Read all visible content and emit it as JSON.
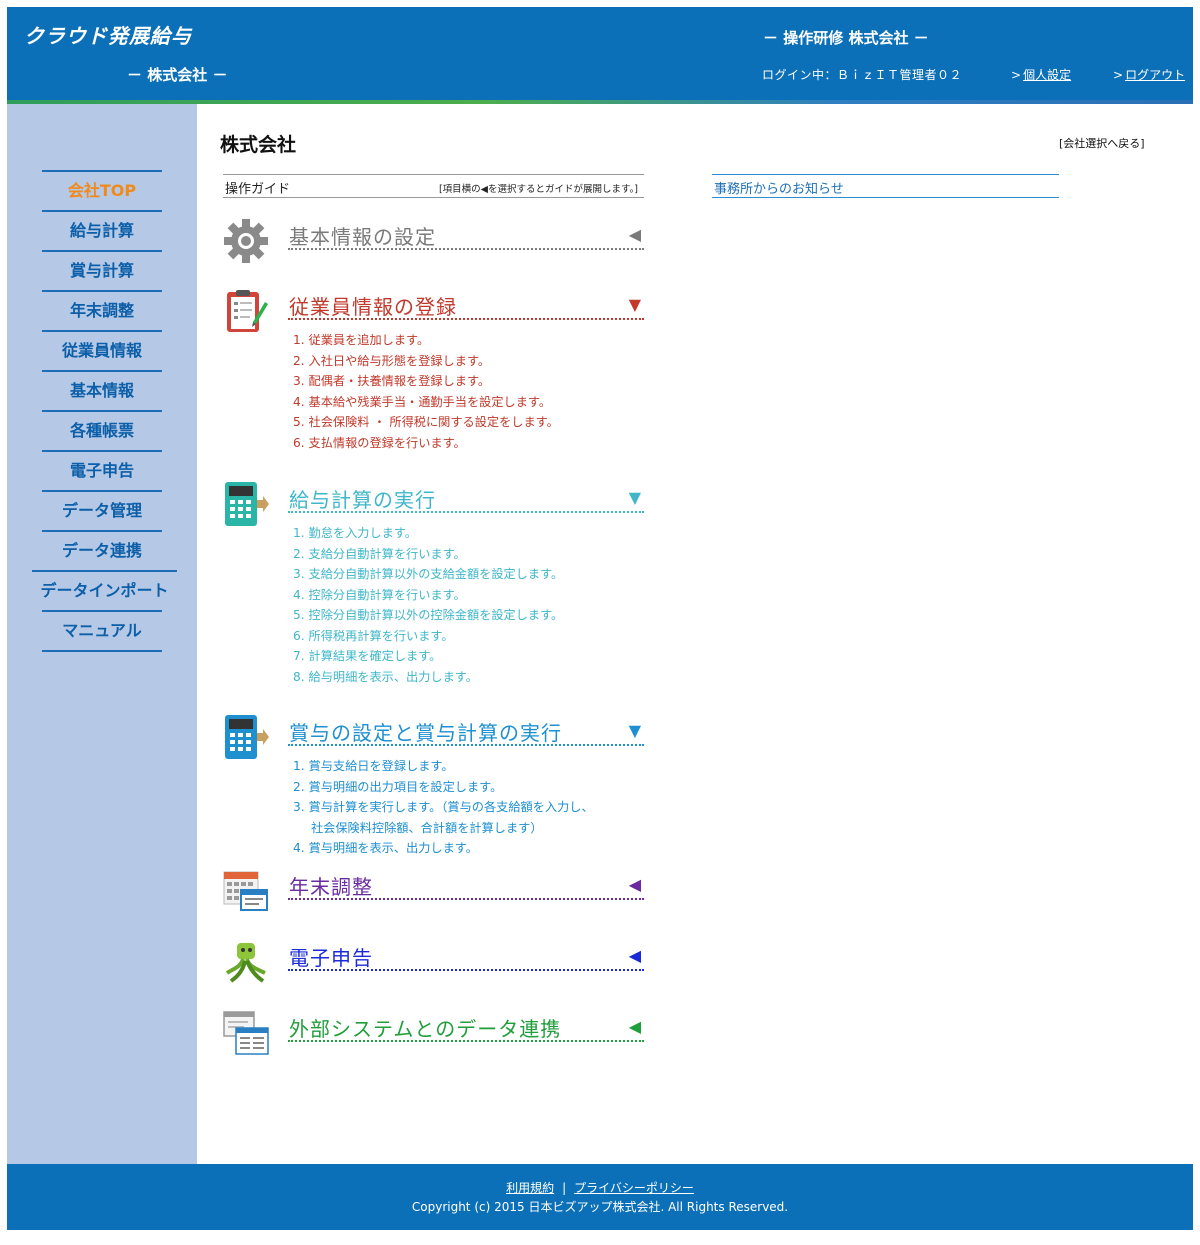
{
  "header": {
    "logo": "クラウド発展給与",
    "company_left": "－ 株式会社 －",
    "company_center": "－ 操作研修 株式会社 －",
    "login_info": "ログイン中：ＢｉｚＩＴ管理者０２",
    "personal_settings": "個人設定",
    "logout": "ログアウト",
    "link_arrow": ">"
  },
  "sidebar": {
    "items": [
      {
        "label": "会社TOP"
      },
      {
        "label": "給与計算"
      },
      {
        "label": "賞与計算"
      },
      {
        "label": "年末調整"
      },
      {
        "label": "従業員情報"
      },
      {
        "label": "基本情報"
      },
      {
        "label": "各種帳票"
      },
      {
        "label": "電子申告"
      },
      {
        "label": "データ管理"
      },
      {
        "label": "データ連携"
      },
      {
        "label": "データインポート"
      },
      {
        "label": "マニュアル"
      }
    ]
  },
  "main": {
    "title": "株式会社",
    "back_link": "[会社選択へ戻る]",
    "guide_title": "操作ガイド",
    "guide_hint": "[項目横の◀を選択するとガイドが展開します。]",
    "notice_title": "事務所からのお知らせ"
  },
  "sections": [
    {
      "title": "基本情報の設定",
      "toggle": "◀",
      "color": "#7a7a7a",
      "icon": "gear-icon",
      "steps": []
    },
    {
      "title": "従業員情報の登録",
      "toggle": "▼",
      "color": "#c0392b",
      "icon": "clipboard-icon",
      "steps": [
        "1. 従業員を追加します。",
        "2. 入社日や給与形態を登録します。",
        "3. 配偶者・扶養情報を登録します。",
        "4. 基本給や残業手当・通勤手当を設定します。",
        "5. 社会保険料 ・ 所得税に関する設定をします。",
        "6. 支払情報の登録を行います。"
      ]
    },
    {
      "title": "給与計算の実行",
      "toggle": "▼",
      "color": "#3fb7c9",
      "icon": "calculator-icon",
      "steps": [
        "1. 勤怠を入力します。",
        "2. 支給分自動計算を行います。",
        "3. 支給分自動計算以外の支給金額を設定します。",
        "4. 控除分自動計算を行います。",
        "5. 控除分自動計算以外の控除金額を設定します。",
        "6. 所得税再計算を行います。",
        "7. 計算結果を確定します。",
        "8. 給与明細を表示、出力します。"
      ]
    },
    {
      "title": "賞与の設定と賞与計算の実行",
      "toggle": "▼",
      "color": "#1e8fd0",
      "icon": "calculator-icon",
      "steps": [
        "1. 賞与支給日を登録します。",
        "2. 賞与明細の出力項目を設定します。",
        "3. 賞与計算を実行します。（賞与の各支給額を入力し、",
        "社会保険料控除額、合計額を計算します）",
        "4. 賞与明細を表示、出力します。"
      ]
    },
    {
      "title": "年末調整",
      "toggle": "◀",
      "color": "#6a2aa0",
      "icon": "calendar-icon",
      "steps": []
    },
    {
      "title": "電子申告",
      "toggle": "◀",
      "color": "#1a2ad8",
      "icon": "e-tax-mascot-icon",
      "steps": []
    },
    {
      "title": "外部システムとのデータ連携",
      "toggle": "◀",
      "color": "#1f9e3a",
      "icon": "data-link-icon",
      "steps": []
    }
  ],
  "footer": {
    "terms": "利用規約",
    "separator": "|",
    "privacy": "プライバシーポリシー",
    "copyright": "Copyright (c) 2015 日本ビズアップ株式会社. All Rights Reserved."
  }
}
